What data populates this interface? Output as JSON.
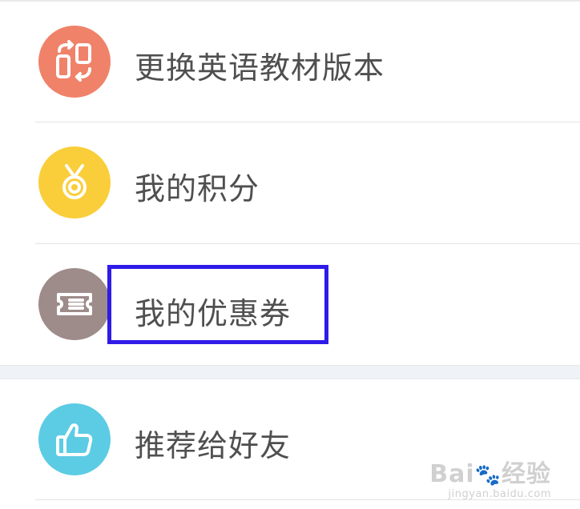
{
  "menu": {
    "items": [
      {
        "label": "更换英语教材版本",
        "icon": "switch-icon",
        "color": "#F0826A"
      },
      {
        "label": "我的积分",
        "icon": "medal-icon",
        "color": "#FACE3A"
      },
      {
        "label": "我的优惠券",
        "icon": "coupon-icon",
        "color": "#9E8C8A"
      },
      {
        "label": "推荐给好友",
        "icon": "thumbs-up-icon",
        "color": "#5CCCE4"
      }
    ]
  },
  "highlight": {
    "color": "#2F1BE8"
  },
  "watermark": {
    "brand": "Bai",
    "paw": "🐾",
    "brand2": "经验",
    "url": "jingyan.baidu.com"
  }
}
